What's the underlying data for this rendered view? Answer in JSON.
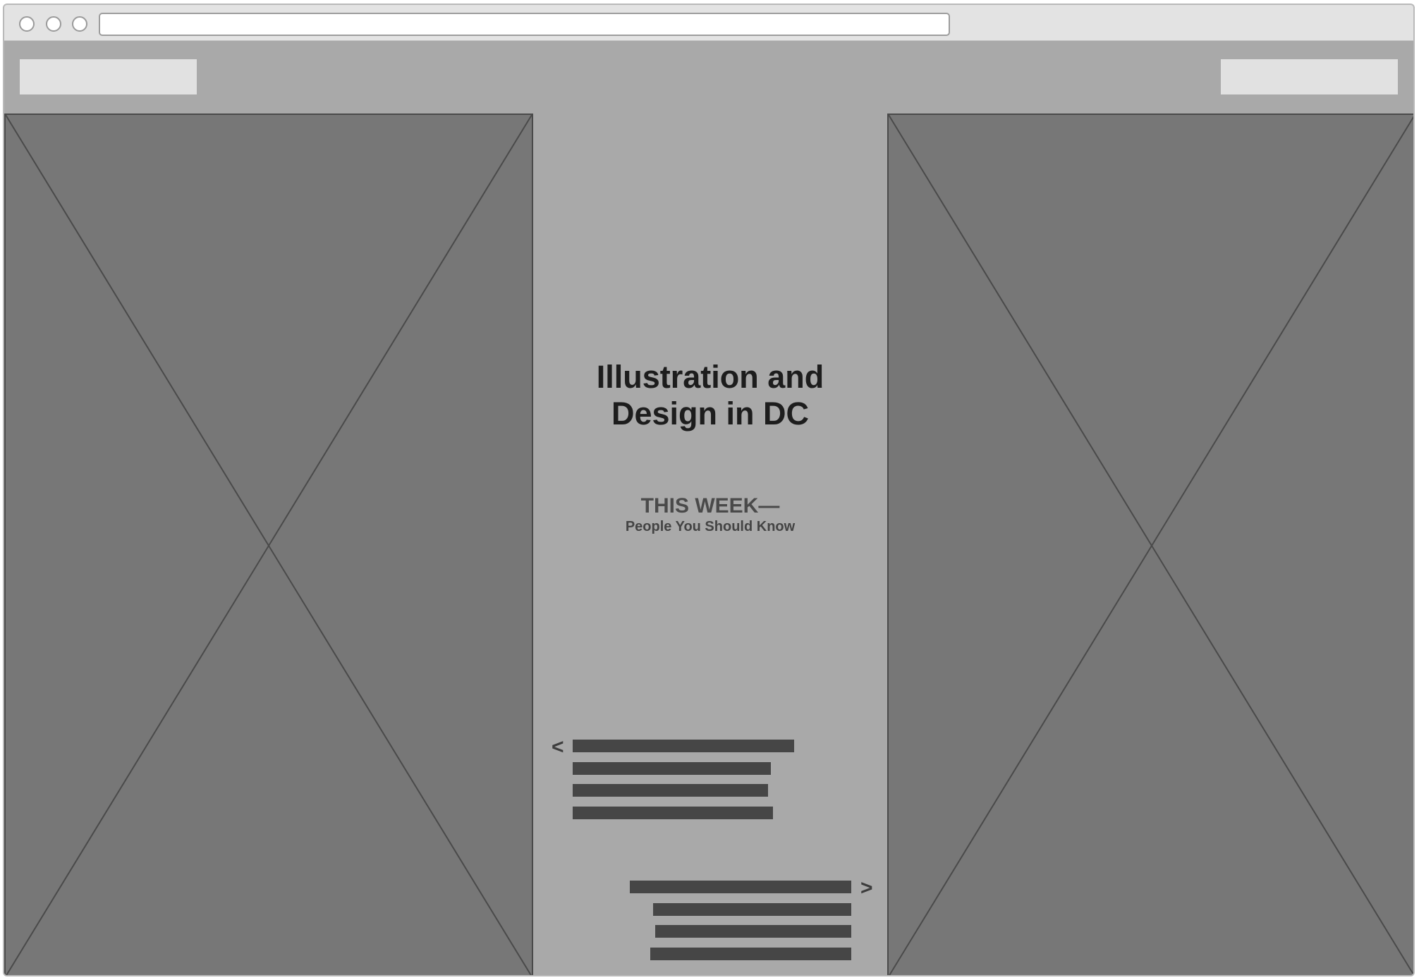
{
  "browser": {
    "window_buttons": [
      "close-button",
      "minimize-button",
      "zoom-button"
    ],
    "address_value": ""
  },
  "header": {
    "logo_placeholder": "",
    "nav_placeholder": ""
  },
  "main": {
    "title_line1": "Illustration and",
    "title_line2": "Design in DC",
    "week_label": "THIS WEEK—",
    "subtitle": "People You Should Know",
    "prev_arrow": "<",
    "next_arrow": ">"
  },
  "colors": {
    "panel": "#777777",
    "background": "#a9a9a9",
    "text_bar": "#464646"
  }
}
